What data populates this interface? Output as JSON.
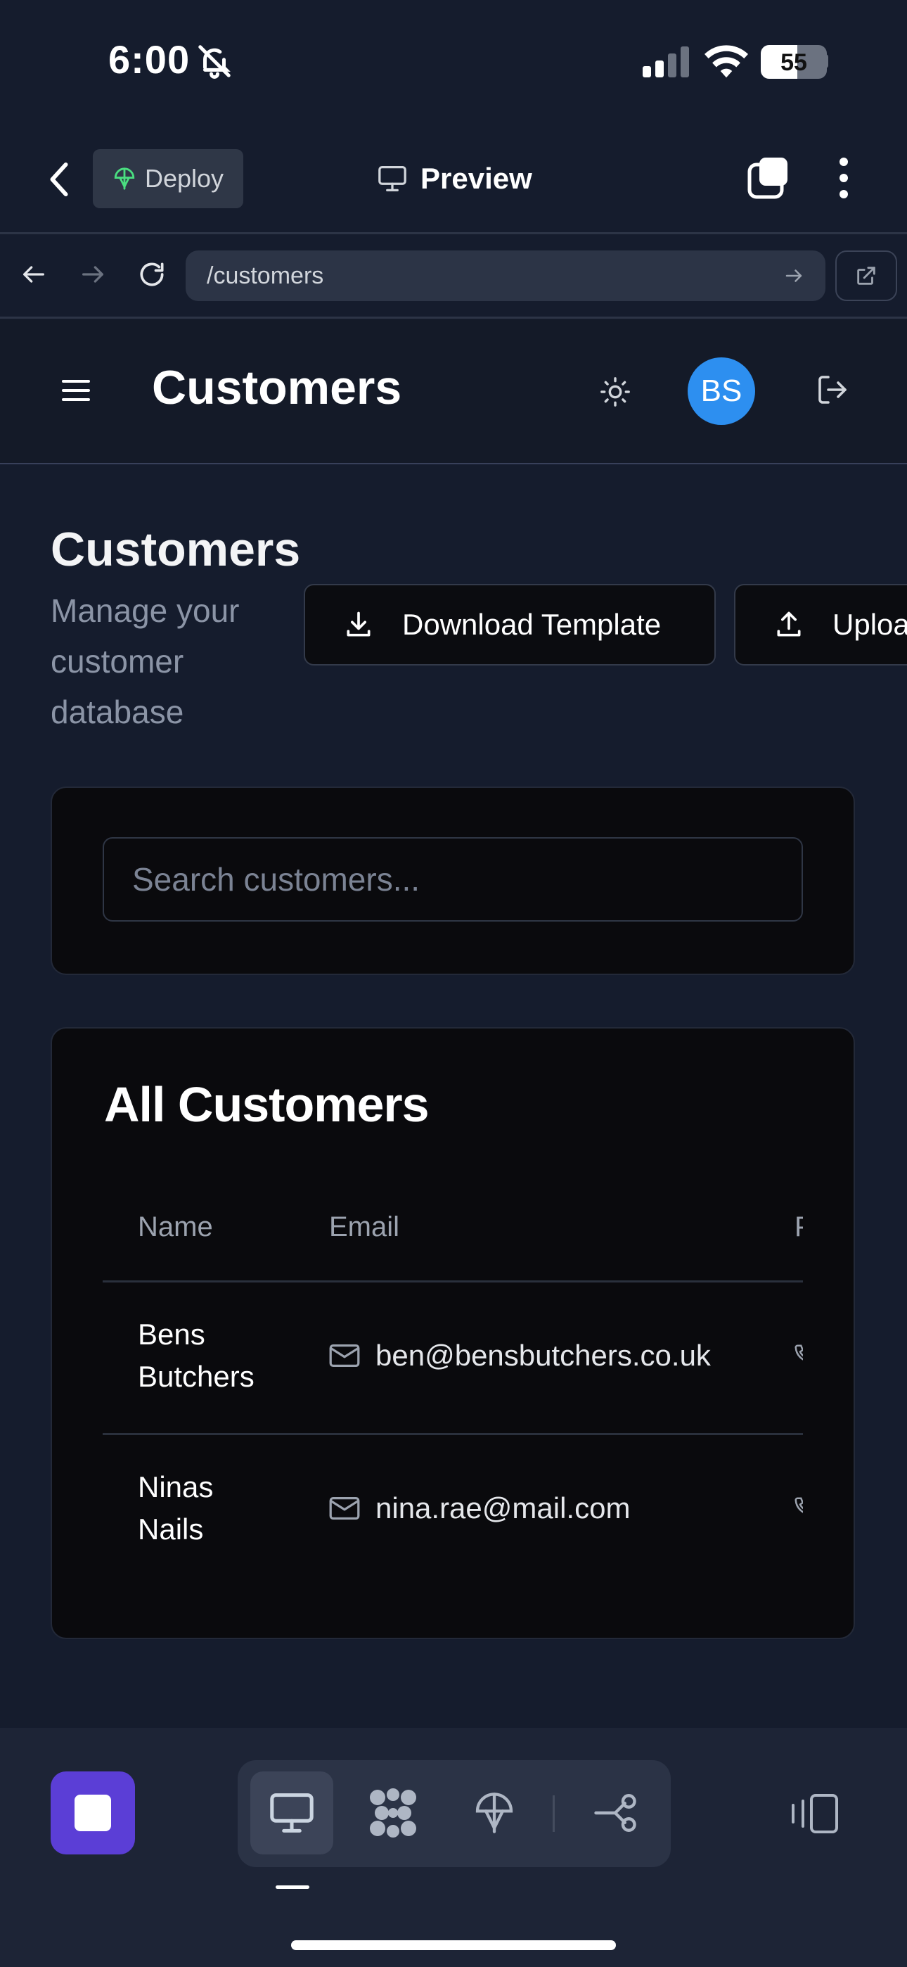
{
  "status_bar": {
    "time": "6:00",
    "battery": "55",
    "battery_level": 0.55
  },
  "top_bar": {
    "deploy_label": "Deploy",
    "preview_label": "Preview"
  },
  "browser": {
    "url": "/customers"
  },
  "header": {
    "title": "Customers",
    "avatar_initials": "BS"
  },
  "page": {
    "title": "Customers",
    "subtitle": "Manage your customer database",
    "download_label": "Download Template",
    "upload_label": "Uploa"
  },
  "search": {
    "placeholder": "Search customers..."
  },
  "customers": {
    "title": "All Customers",
    "columns": [
      "Name",
      "Email",
      "P"
    ],
    "rows": [
      {
        "name_line1": "Bens",
        "name_line2": "Butchers",
        "email": "ben@bensbutchers.co.uk"
      },
      {
        "name_line1": "Ninas",
        "name_line2": "Nails",
        "email": "nina.rae@mail.com"
      }
    ]
  },
  "colors": {
    "background": "#151c2d",
    "accent": "#2d8ff0",
    "stop": "#5b3ed6"
  }
}
